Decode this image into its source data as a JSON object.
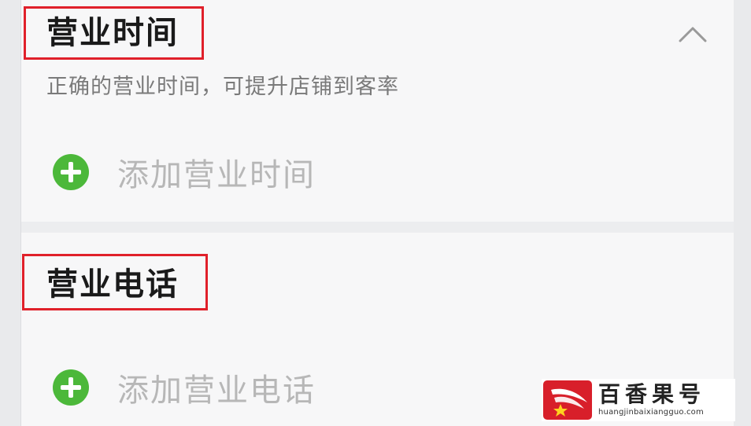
{
  "business_hours": {
    "title": "营业时间",
    "subtitle": "正确的营业时间，可提升店铺到客率",
    "add_label": "添加营业时间",
    "collapse_icon": "chevron-up-icon"
  },
  "business_phone": {
    "title": "营业电话",
    "add_label": "添加营业电话"
  },
  "watermark": {
    "name": "百香果号",
    "url": "huangjinbaixiangguo.com"
  },
  "colors": {
    "accent_green": "#4cb83a",
    "highlight_red": "#e0202a",
    "title": "#1a1a1a",
    "subtitle": "#7a7a7a",
    "placeholder": "#b7b7b7",
    "background": "#f7f7f8"
  }
}
